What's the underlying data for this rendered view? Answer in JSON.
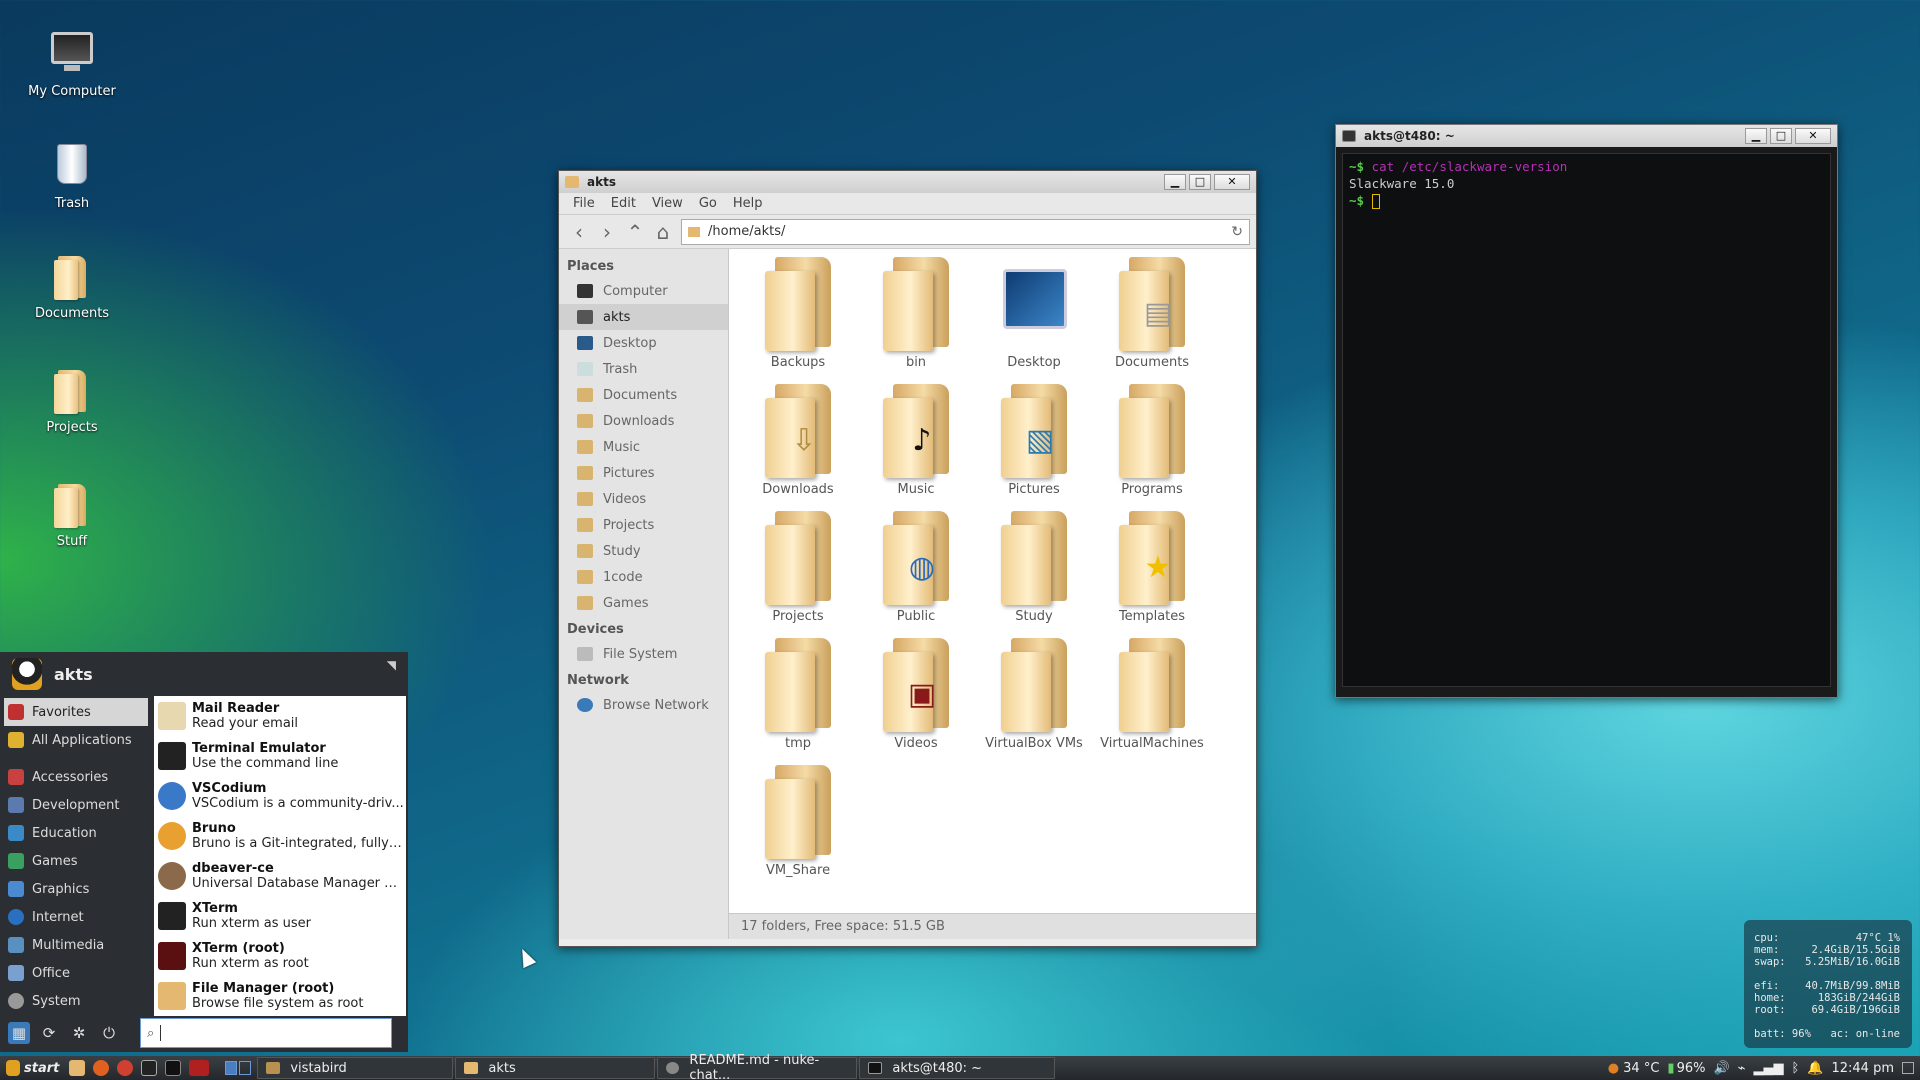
{
  "desktop": {
    "icons": [
      {
        "label": "My Computer",
        "icon": "computer-icon"
      },
      {
        "label": "Trash",
        "icon": "trash-icon"
      },
      {
        "label": "Documents",
        "icon": "folder-icon"
      },
      {
        "label": "Projects",
        "icon": "folder-icon"
      },
      {
        "label": "Stuff",
        "icon": "folder-icon"
      }
    ]
  },
  "file_manager": {
    "title": "akts",
    "menu": [
      "File",
      "Edit",
      "View",
      "Go",
      "Help"
    ],
    "path": "/home/akts/",
    "sidebar": {
      "places_label": "Places",
      "places": [
        "Computer",
        "akts",
        "Desktop",
        "Trash",
        "Documents",
        "Downloads",
        "Music",
        "Pictures",
        "Videos",
        "Projects",
        "Study",
        "1code",
        "Games"
      ],
      "active": "akts",
      "devices_label": "Devices",
      "devices": [
        "File System"
      ],
      "network_label": "Network",
      "network": [
        "Browse Network"
      ]
    },
    "items": [
      "Backups",
      "bin",
      "Desktop",
      "Documents",
      "Downloads",
      "Music",
      "Pictures",
      "Programs",
      "Projects",
      "Public",
      "Study",
      "Templates",
      "tmp",
      "Videos",
      "VirtualBox VMs",
      "VirtualMachines",
      "VM_Share"
    ],
    "status": "17 folders, Free space: 51.5 GB"
  },
  "terminal": {
    "title": "akts@t480: ~",
    "prompt": "~$",
    "command": "cat /etc/slackware-version",
    "output": "Slackware 15.0",
    "colors": {
      "prompt": "#5ac84c",
      "command": "#b430b4"
    }
  },
  "start_menu": {
    "user": "akts",
    "categories_top": [
      "Favorites",
      "All Applications"
    ],
    "categories": [
      "Accessories",
      "Development",
      "Education",
      "Games",
      "Graphics",
      "Internet",
      "Multimedia",
      "Office",
      "System"
    ],
    "active": "Favorites",
    "apps": [
      {
        "name": "Mail Reader",
        "desc": "Read your email"
      },
      {
        "name": "Terminal Emulator",
        "desc": "Use the command line"
      },
      {
        "name": "VSCodium",
        "desc": "VSCodium is a community-driv..."
      },
      {
        "name": "Bruno",
        "desc": "Bruno is a Git-integrated, fully ..."
      },
      {
        "name": "dbeaver-ce",
        "desc": "Universal Database Manager a..."
      },
      {
        "name": "XTerm",
        "desc": "Run xterm as user"
      },
      {
        "name": "XTerm (root)",
        "desc": "Run xterm as root"
      },
      {
        "name": "File Manager (root)",
        "desc": "Browse file system as root"
      }
    ],
    "search_value": ""
  },
  "conky": {
    "rows1": [
      [
        "cpu:",
        "47°C 1%"
      ],
      [
        "mem:",
        "2.4GiB/15.5GiB"
      ],
      [
        "swap:",
        "5.25MiB/16.0GiB"
      ]
    ],
    "rows2": [
      [
        "efi:",
        "40.7MiB/99.8MiB"
      ],
      [
        "home:",
        "183GiB/244GiB"
      ],
      [
        "root:",
        "69.4GiB/196GiB"
      ]
    ],
    "batt": "batt: 96%",
    "ac": "ac: on-line"
  },
  "taskbar": {
    "start_label": "start",
    "tasks": [
      "vistabird",
      "akts",
      "README.md - nuke-chat...",
      "akts@t480: ~"
    ],
    "tray": {
      "temp": "34 °C",
      "battery": "96%",
      "clock": "12:44 pm"
    }
  }
}
